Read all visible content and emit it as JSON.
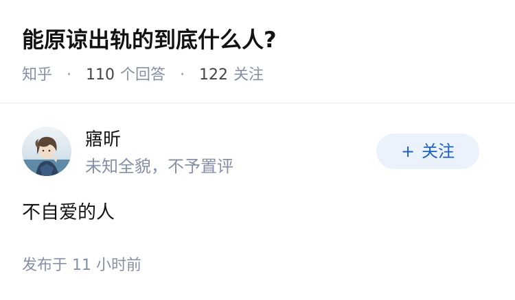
{
  "question": {
    "title": "能原谅出轨的到底什么人?",
    "source": "知乎",
    "separator": "·",
    "answer_count": "110",
    "answer_label": "个回答",
    "follow_count": "122",
    "follow_label": "关注"
  },
  "answer": {
    "author_name": "寤昕",
    "author_bio": "未知全貌，不予置评",
    "follow_button_plus": "+",
    "follow_button_label": "关注",
    "content": "不自爱的人",
    "publish_label": "发布于",
    "publish_time": "11 小时前"
  },
  "colors": {
    "accent": "#1b60c9",
    "accent_bg": "#ebf2fb",
    "secondary_text": "#8590a6"
  }
}
